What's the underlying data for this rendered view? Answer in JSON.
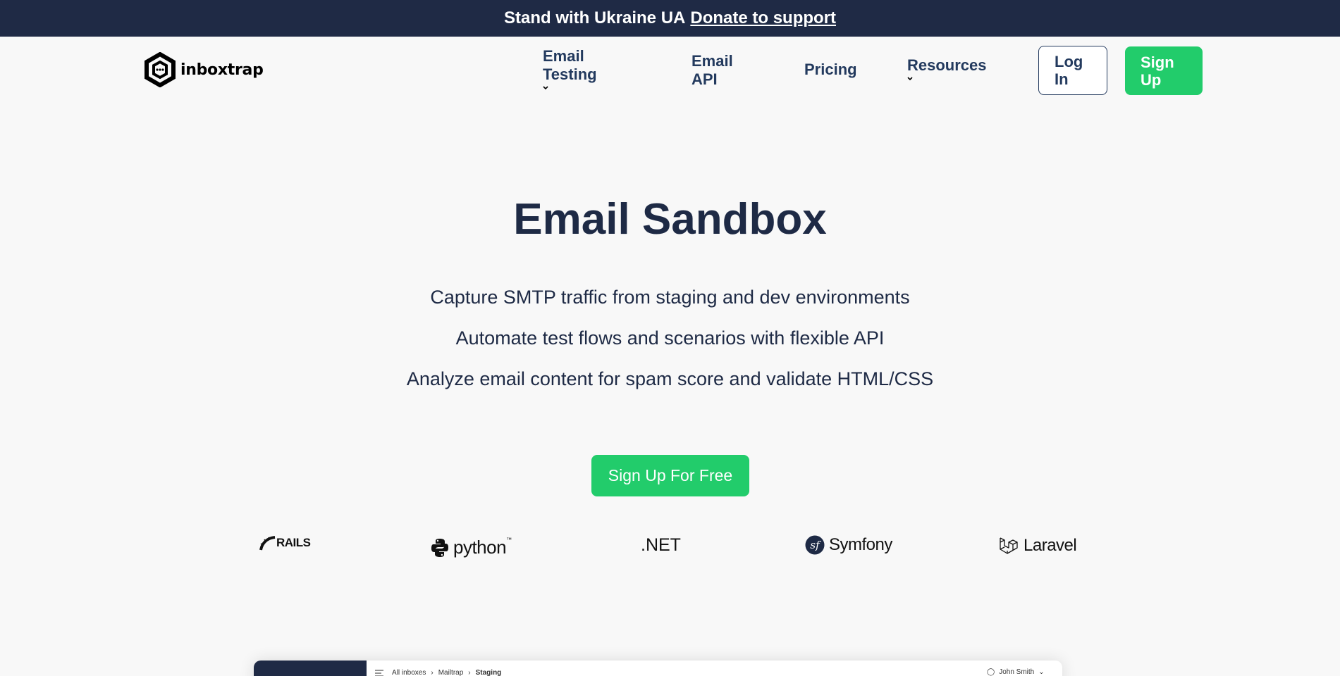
{
  "banner": {
    "text": "Stand with Ukraine UA",
    "link": "Donate to support"
  },
  "nav": {
    "logo": "inboxtrap",
    "items": [
      {
        "line1": "Email",
        "line2": "Testing"
      },
      {
        "line1": "Email",
        "line2": "API"
      },
      {
        "label": "Pricing"
      },
      {
        "label": "Resources"
      }
    ],
    "login": {
      "line1": "Log",
      "line2": "In"
    },
    "signup": {
      "line1": "Sign",
      "line2": "Up"
    }
  },
  "hero": {
    "title": "Email Sandbox",
    "features": [
      "Capture SMTP traffic from staging and dev environments",
      "Automate test flows and scenarios with flexible API",
      "Analyze email content for spam score and validate HTML/CSS"
    ],
    "cta": "Sign Up For Free"
  },
  "tech": {
    "rails": "RAILS",
    "python": "python",
    "python_tm": "™",
    "net": ".NET",
    "symfony": "Symfony",
    "laravel": "Laravel"
  },
  "preview": {
    "breadcrumbs": [
      "All inboxes",
      "Mailtrap",
      "Staging"
    ],
    "user": "John Smith"
  },
  "colors": {
    "banner": "#1f2a45",
    "accent": "#22cc6b",
    "text": "#1e2a45"
  }
}
